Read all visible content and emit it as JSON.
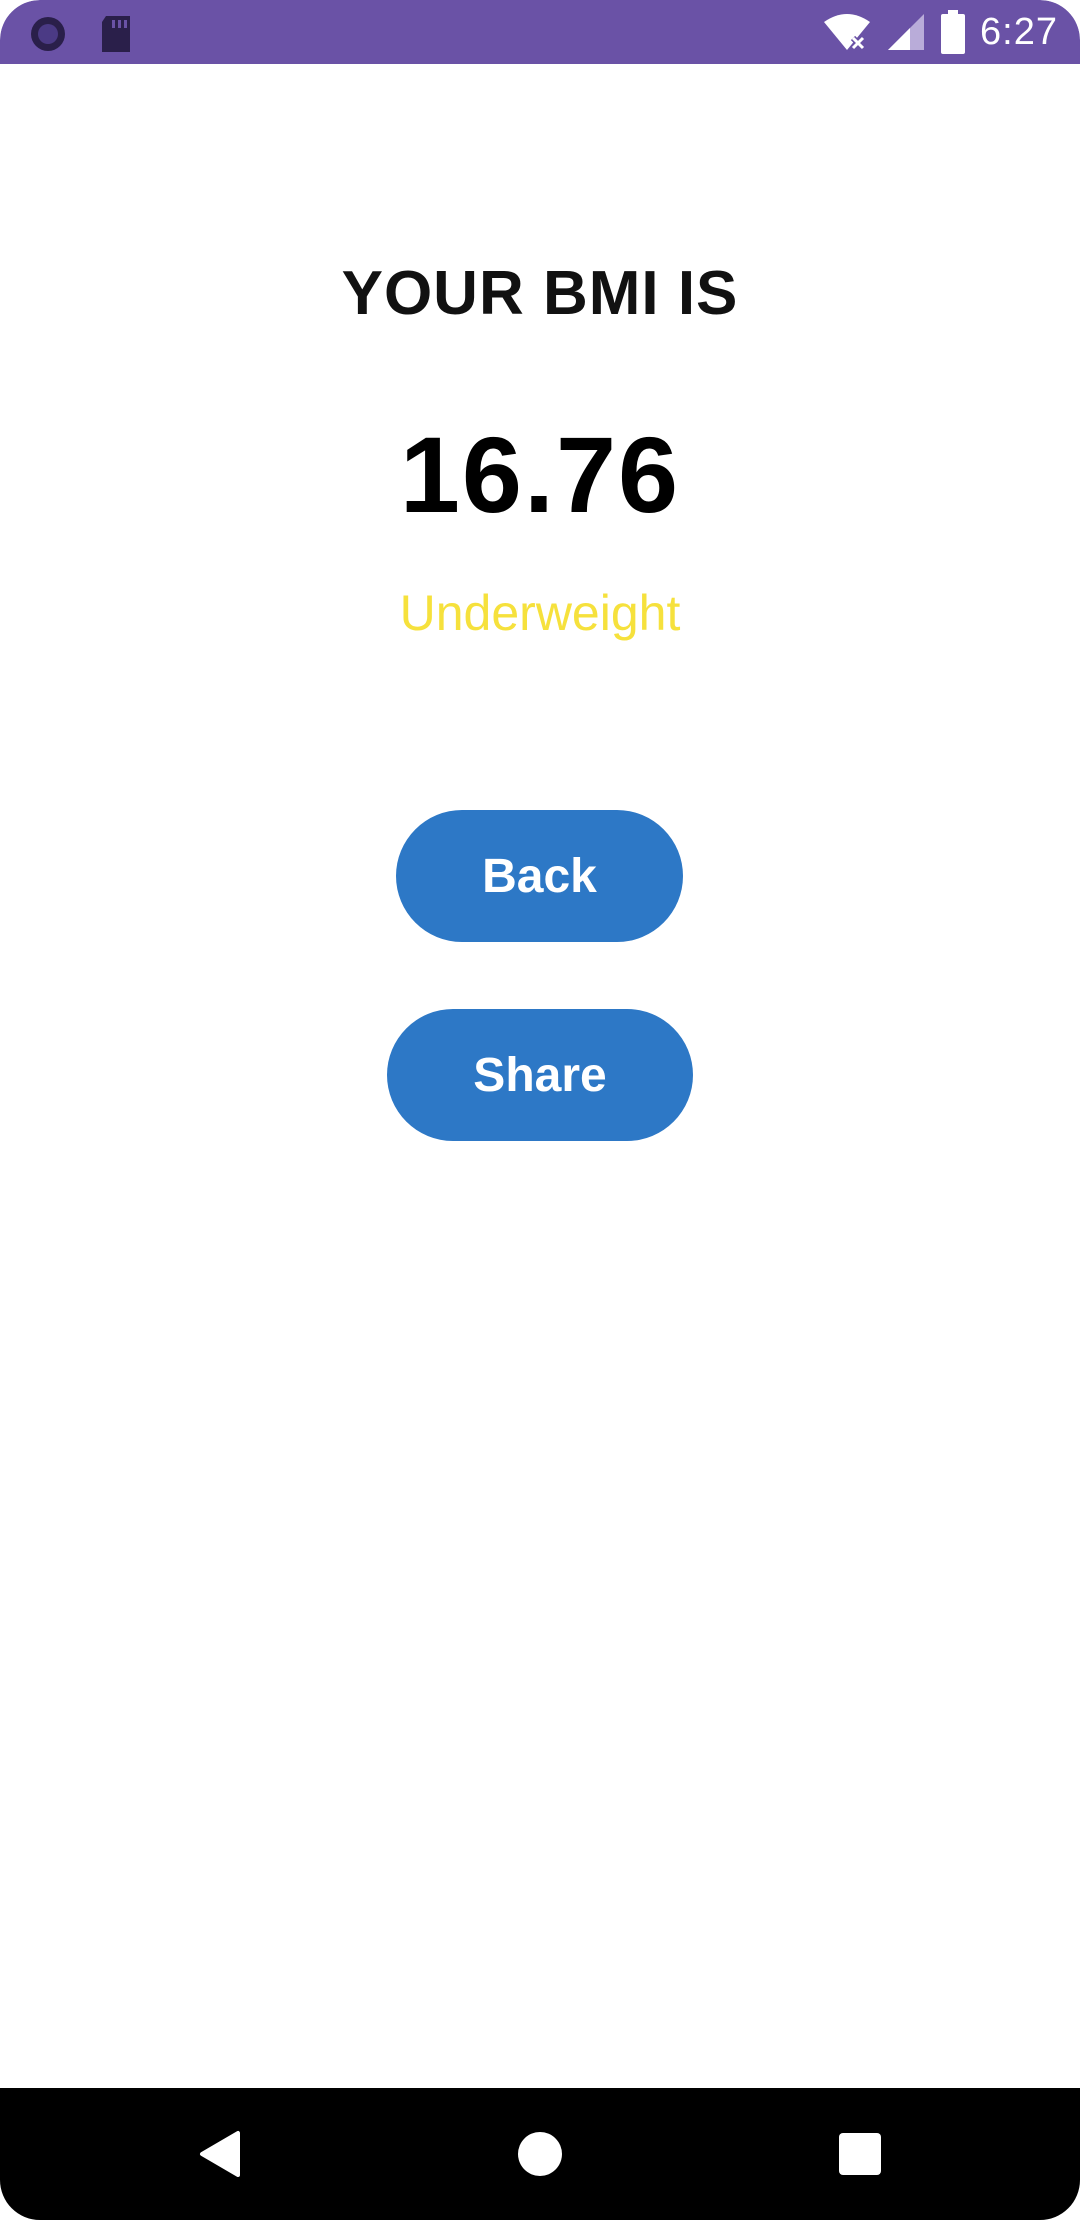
{
  "status_bar": {
    "time": "6:27",
    "background_color": "#6a52a6",
    "left_icons": [
      "circle-icon",
      "sd-card-icon"
    ],
    "right_icons": [
      "wifi-off-icon",
      "signal-icon",
      "battery-icon"
    ]
  },
  "result": {
    "title": "YOUR BMI IS",
    "bmi_value": "16.76",
    "category": "Underweight",
    "category_color": "#f6e13c"
  },
  "actions": {
    "back_label": "Back",
    "share_label": "Share",
    "button_color": "#2d78c6"
  },
  "nav_bar": {
    "icons": [
      "back-triangle-icon",
      "home-circle-icon",
      "recents-square-icon"
    ]
  }
}
